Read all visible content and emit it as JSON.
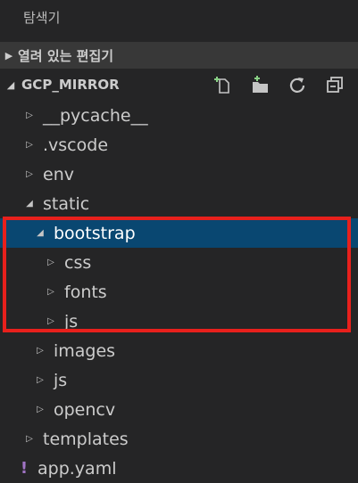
{
  "explorer": {
    "title": "탐색기"
  },
  "open_editors": {
    "label": "열려 있는 편집기"
  },
  "workspace": {
    "label": "GCP_MIRROR",
    "actions": [
      {
        "name": "new-file-icon"
      },
      {
        "name": "new-folder-icon"
      },
      {
        "name": "refresh-icon"
      },
      {
        "name": "collapse-all-icon"
      }
    ]
  },
  "tree": [
    {
      "label": "__pycache__",
      "type": "folder",
      "expanded": false
    },
    {
      "label": ".vscode",
      "type": "folder",
      "expanded": false
    },
    {
      "label": "env",
      "type": "folder",
      "expanded": false
    },
    {
      "label": "static",
      "type": "folder",
      "expanded": true
    },
    {
      "label": "bootstrap",
      "type": "folder",
      "expanded": true,
      "selected": true
    },
    {
      "label": "css",
      "type": "folder",
      "expanded": false
    },
    {
      "label": "fonts",
      "type": "folder",
      "expanded": false
    },
    {
      "label": "js",
      "type": "folder",
      "expanded": false
    },
    {
      "label": "images",
      "type": "folder",
      "expanded": false
    },
    {
      "label": "js",
      "type": "folder",
      "expanded": false
    },
    {
      "label": "opencv",
      "type": "folder",
      "expanded": false
    },
    {
      "label": "templates",
      "type": "folder",
      "expanded": false
    },
    {
      "label": "app.yaml",
      "type": "file",
      "icon": "yaml-icon"
    }
  ],
  "colors": {
    "background": "#252526",
    "selection": "#094771",
    "highlight_border": "#e8201c"
  }
}
